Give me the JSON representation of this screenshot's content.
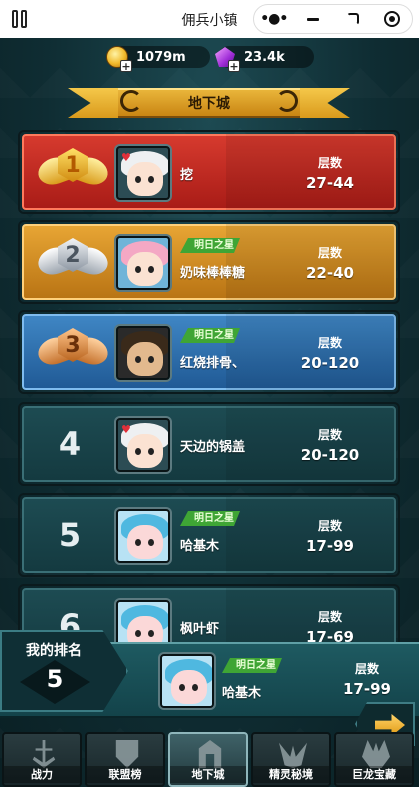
{
  "app": {
    "title": "佣兵小镇"
  },
  "resources": {
    "gold": "1079m",
    "gems": "23.4k"
  },
  "banner": {
    "title": "地下城"
  },
  "floor_label": "层数",
  "rows": [
    {
      "rank": "1",
      "name": "挖",
      "tag": "",
      "floor": "27-44"
    },
    {
      "rank": "2",
      "name": "奶味棒棒糖",
      "tag": "明日之星",
      "floor": "22-40"
    },
    {
      "rank": "3",
      "name": "红烧排骨、",
      "tag": "明日之星",
      "floor": "20-120"
    },
    {
      "rank": "4",
      "name": "天边的锅盖",
      "tag": "",
      "floor": "20-120"
    },
    {
      "rank": "5",
      "name": "哈基木",
      "tag": "明日之星",
      "floor": "17-99"
    },
    {
      "rank": "6",
      "name": "枫叶虾",
      "tag": "",
      "floor": "17-69"
    }
  ],
  "my_rank": {
    "label": "我的排名",
    "rank": "5",
    "name": "哈基木",
    "tag": "明日之星",
    "floor": "17-99"
  },
  "tabs": [
    {
      "label": "战力",
      "icon": "anchor-icon"
    },
    {
      "label": "联盟榜",
      "icon": "shield-icon"
    },
    {
      "label": "地下城",
      "icon": "gate-icon",
      "active": true
    },
    {
      "label": "精灵秘境",
      "icon": "wings-icon"
    },
    {
      "label": "巨龙宝藏",
      "icon": "dragon-icon"
    }
  ],
  "colors": {
    "rank1": "#d63a2e",
    "rank2": "#e7a534",
    "rank3": "#3f86c4",
    "tag": "#3fa535",
    "accent": "#f0b92a"
  }
}
